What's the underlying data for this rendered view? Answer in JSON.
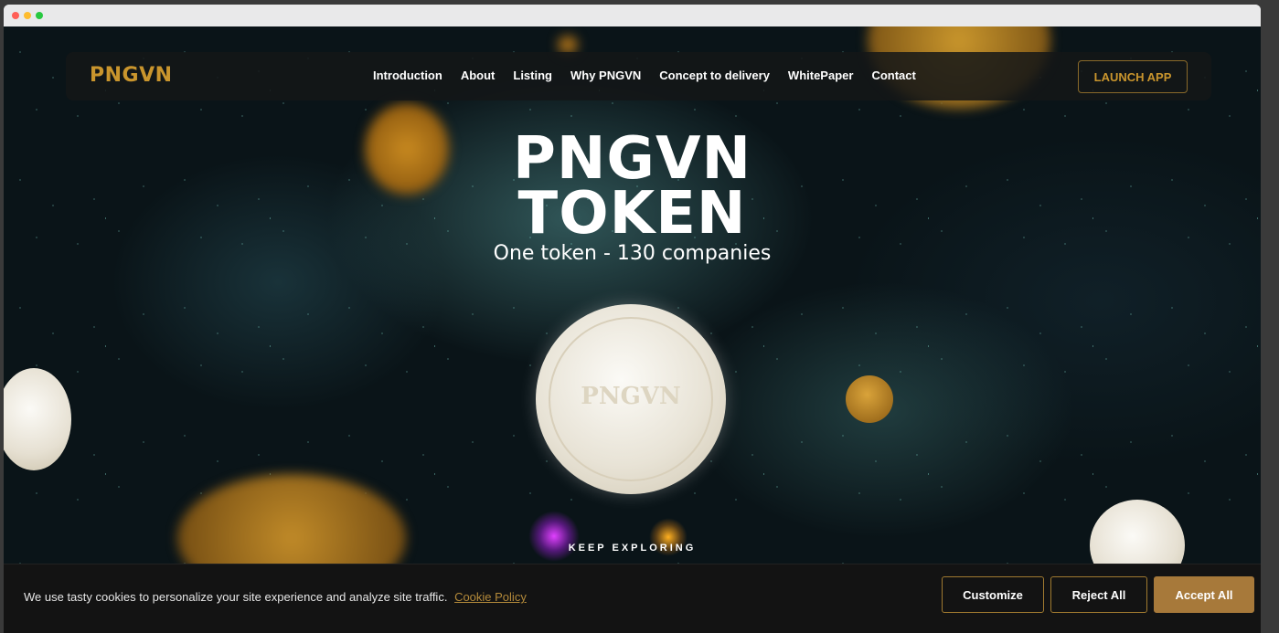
{
  "colors": {
    "accent_gold": "#c9952d",
    "button_fill": "#a7793a",
    "link_gold": "#b48a3a"
  },
  "nav": {
    "logo": "PNGVN",
    "links": [
      "Introduction",
      "About",
      "Listing",
      "Why PNGVN",
      "Concept to delivery",
      "WhitePaper",
      "Contact"
    ],
    "launch_label": "LAUNCH APP"
  },
  "hero": {
    "title_line1": "PNGVN",
    "title_line2": "TOKEN",
    "subtitle": "One token - 130 companies",
    "coin_mark": "PNGVN",
    "keep_exploring": "KEEP EXPLORING"
  },
  "cookie": {
    "text": "We use tasty cookies to personalize your site experience and analyze site traffic.",
    "policy_link": "Cookie Policy",
    "customize": "Customize",
    "reject": "Reject All",
    "accept": "Accept All"
  }
}
